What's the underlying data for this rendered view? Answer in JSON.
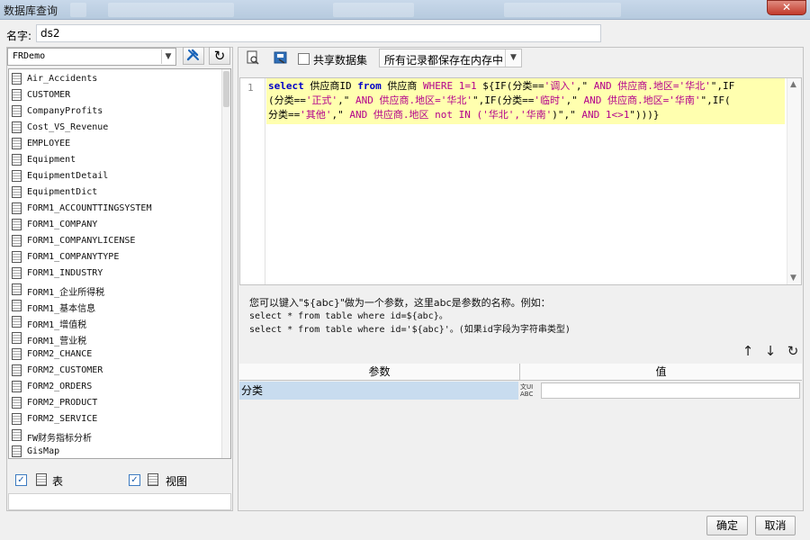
{
  "window": {
    "title": "数据库查询",
    "close_label": "✕"
  },
  "name_field": {
    "label": "名字:",
    "value": "ds2"
  },
  "datasource": {
    "selected": "FRDemo"
  },
  "tables": [
    "Air_Accidents",
    "CUSTOMER",
    "CompanyProfits",
    "Cost_VS_Revenue",
    "EMPLOYEE",
    "Equipment",
    "EquipmentDetail",
    "EquipmentDict",
    "FORM1_ACCOUNTTINGSYSTEM",
    "FORM1_COMPANY",
    "FORM1_COMPANYLICENSE",
    "FORM1_COMPANYTYPE",
    "FORM1_INDUSTRY",
    "FORM1_企业所得税",
    "FORM1_基本信息",
    "FORM1_增值税",
    "FORM1_营业税",
    "FORM2_CHANCE",
    "FORM2_CUSTOMER",
    "FORM2_ORDERS",
    "FORM2_PRODUCT",
    "FORM2_SERVICE",
    "FW财务指标分析",
    "GisMap"
  ],
  "filters": {
    "table_label": "表",
    "view_label": "视图",
    "table_checked": true,
    "view_checked": true
  },
  "toolbar": {
    "share_label": "共享数据集",
    "save_mode": "所有记录都保存在内存中"
  },
  "editor": {
    "line_number": "1",
    "sql_lines": [
      [
        {
          "t": "select",
          "c": "kw"
        },
        {
          "t": " 供应商ID ",
          "c": ""
        },
        {
          "t": "from",
          "c": "kw"
        },
        {
          "t": " 供应商 ",
          "c": ""
        },
        {
          "t": "WHERE",
          "c": "kw2"
        },
        {
          "t": " 1=1 ",
          "c": "kw2"
        },
        {
          "t": "${IF(分类==",
          "c": ""
        },
        {
          "t": "'调入'",
          "c": "str"
        },
        {
          "t": ",\"",
          "c": ""
        },
        {
          "t": " AND 供应商.地区=",
          "c": "kw2"
        },
        {
          "t": "'华北'",
          "c": "str"
        },
        {
          "t": "\",IF",
          "c": ""
        }
      ],
      [
        {
          "t": "(分类==",
          "c": ""
        },
        {
          "t": "'正式'",
          "c": "str"
        },
        {
          "t": ",\"",
          "c": ""
        },
        {
          "t": " AND 供应商.地区=",
          "c": "kw2"
        },
        {
          "t": "'华北'",
          "c": "str"
        },
        {
          "t": "\",IF(分类==",
          "c": ""
        },
        {
          "t": "'临时'",
          "c": "str"
        },
        {
          "t": ",\"",
          "c": ""
        },
        {
          "t": " AND 供应商.地区=",
          "c": "kw2"
        },
        {
          "t": "'华南'",
          "c": "str"
        },
        {
          "t": "\",IF(",
          "c": ""
        }
      ],
      [
        {
          "t": "分类==",
          "c": ""
        },
        {
          "t": "'其他'",
          "c": "str"
        },
        {
          "t": ",\"",
          "c": ""
        },
        {
          "t": " AND 供应商.地区 not IN (",
          "c": "kw2"
        },
        {
          "t": "'华北'",
          "c": "str"
        },
        {
          "t": ",",
          "c": "kw2"
        },
        {
          "t": "'华南'",
          "c": "str"
        },
        {
          "t": ")\",\"",
          "c": ""
        },
        {
          "t": " AND 1<>1",
          "c": "kw2"
        },
        {
          "t": "\")))}",
          "c": ""
        }
      ]
    ]
  },
  "hint": {
    "line1": "您可以键入\"${abc}\"做为一个参数，这里abc是参数的名称。例如：",
    "line2": "select * from table where id=${abc}。",
    "line3": "select * from table where id='${abc}'。(如果id字段为字符串类型)"
  },
  "params": {
    "col_param": "参数",
    "col_value": "值",
    "rows": [
      {
        "name": "分类",
        "type_line1": "文UI",
        "type_line2": "ABC",
        "value": ""
      }
    ]
  },
  "buttons": {
    "ok": "确定",
    "cancel": "取消"
  },
  "icons": {
    "filter": "wrench-icon",
    "refresh": "refresh-icon",
    "preview": "preview-icon",
    "save": "save-icon",
    "up": "arrow-up-icon",
    "down": "arrow-down-icon",
    "refresh_params": "refresh-icon"
  }
}
